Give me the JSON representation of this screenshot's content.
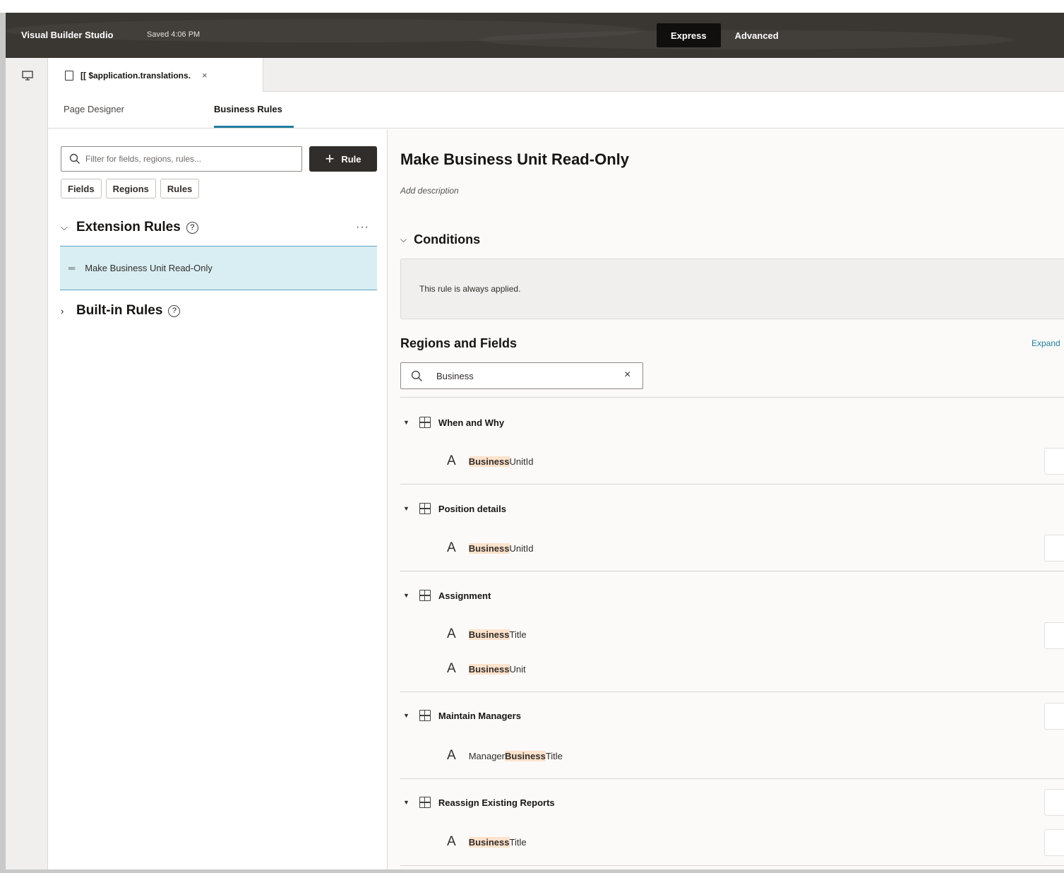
{
  "header": {
    "brand": "Visual Builder Studio",
    "saved": "Saved 4:06 PM",
    "modes": [
      {
        "label": "Express",
        "active": true
      },
      {
        "label": "Advanced",
        "active": false
      }
    ]
  },
  "rail": {
    "icon": "monitor-icon"
  },
  "file_tab": {
    "label": "[[ $application.translations.",
    "close": "×"
  },
  "subtabs": [
    {
      "label": "Page Designer",
      "active": false
    },
    {
      "label": "Business Rules",
      "active": true
    }
  ],
  "left": {
    "filter_placeholder": "Filter for fields, regions, rules...",
    "rule_button": "Rule",
    "chips": [
      "Fields",
      "Regions",
      "Rules"
    ],
    "extension_rules": "Extension Rules",
    "more": "···",
    "selected_rule": "Make Business Unit Read-Only",
    "builtin_rules": "Built-in Rules"
  },
  "main": {
    "title": "Make Business Unit Read-Only",
    "add_description": "Add description",
    "conditions_title": "Conditions",
    "conditions_text": "This rule is always applied.",
    "regions_title": "Regions and Fields",
    "expand_link": "Expand",
    "search_value": "Business",
    "clear": "×",
    "regions": [
      {
        "name": "When and Why",
        "fields": [
          {
            "pre": "",
            "hl": "Business",
            "post": "UnitId"
          }
        ]
      },
      {
        "name": "Position details",
        "fields": [
          {
            "pre": "",
            "hl": "Business",
            "post": "UnitId"
          }
        ]
      },
      {
        "name": "Assignment",
        "fields": [
          {
            "pre": "",
            "hl": "Business",
            "post": " Title"
          },
          {
            "pre": "",
            "hl": "Business",
            "post": " Unit"
          }
        ]
      },
      {
        "name": "Maintain Managers",
        "fields": [
          {
            "pre": "Manager",
            "hl": "Business",
            "post": "Title"
          }
        ]
      },
      {
        "name": "Reassign Existing Reports",
        "fields": [
          {
            "pre": "",
            "hl": "Business",
            "post": " Title"
          }
        ]
      }
    ]
  }
}
